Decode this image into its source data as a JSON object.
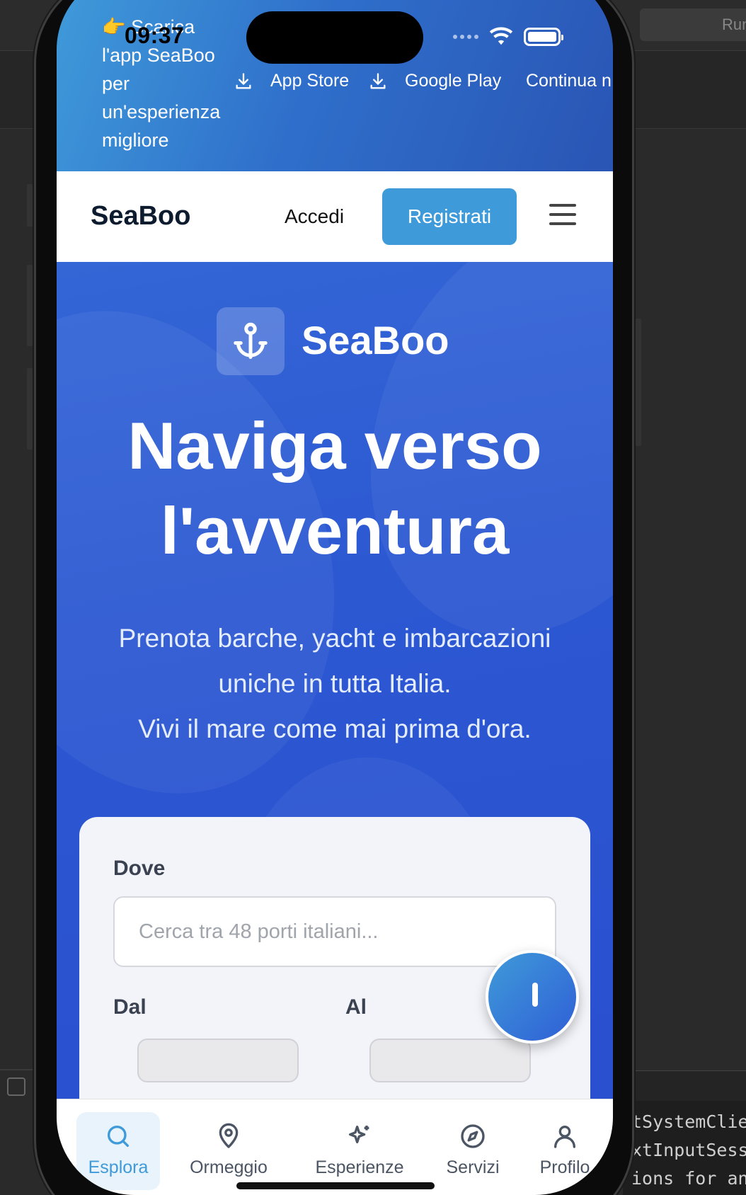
{
  "ide": {
    "runner_label": "Runn",
    "console_lines": [
      "tSystemClie",
      "xtInputSessi",
      "ions for an a"
    ]
  },
  "status_bar": {
    "time": "09:37"
  },
  "promo": {
    "text": "👉 Scarica l'app SeaBoo per un'esperienza migliore",
    "app_store": "App Store",
    "google_play": "Google Play",
    "continue": "Continua n"
  },
  "header": {
    "brand": "SeaBoo",
    "login": "Accedi",
    "register": "Registrati"
  },
  "hero": {
    "logo_name": "SeaBoo",
    "title_line1": "Naviga verso",
    "title_line2": "l'avventura",
    "subtitle_line1": "Prenota barche, yacht e imbarcazioni",
    "subtitle_line2": "uniche in tutta Italia.",
    "subtitle_line3": "Vivi il mare come mai prima d'ora."
  },
  "search": {
    "where_label": "Dove",
    "where_placeholder": "Cerca tra 48 porti italiani...",
    "from_label": "Dal",
    "to_label": "Al"
  },
  "tabs": [
    {
      "label": "Esplora",
      "icon": "search-icon",
      "active": true
    },
    {
      "label": "Ormeggio",
      "icon": "map-pin-icon",
      "active": false
    },
    {
      "label": "Esperienze",
      "icon": "sparkles-icon",
      "active": false
    },
    {
      "label": "Servizi",
      "icon": "compass-icon",
      "active": false
    },
    {
      "label": "Profilo",
      "icon": "user-icon",
      "active": false
    }
  ],
  "colors": {
    "brand_blue": "#3f9ad9",
    "hero_blue": "#2c58d2",
    "dark_text": "#0d1b2e"
  }
}
